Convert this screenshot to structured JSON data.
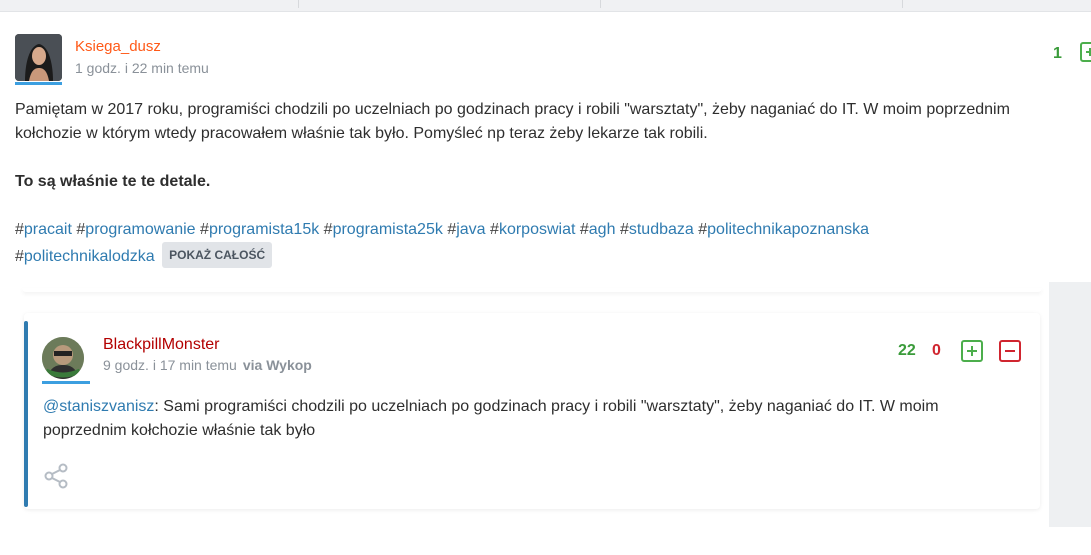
{
  "post": {
    "author": "Ksiega_dusz",
    "time": "1 godz. i 22 min temu",
    "votes": "1",
    "paragraph1": "Pamiętam w 2017 roku, programiści chodzili po uczelniach po godzinach pracy i robili \"warsztaty\", żeby naganiać do IT. W moim poprzednim kołchozie w którym wtedy pracowałem właśnie tak było. Pomyśleć np teraz żeby lekarze tak robili.",
    "paragraph2": "To są właśnie te te detale.",
    "tags": [
      "pracait",
      "programowanie",
      "programista15k",
      "programista25k",
      "java",
      "korposwiat",
      "agh",
      "studbaza",
      "politechnikapoznanska",
      "politechnikalodzka"
    ],
    "show_all": "POKAŻ CAŁOŚĆ"
  },
  "reply": {
    "author": "BlackpillMonster",
    "time": "9 godz. i 17 min temu",
    "via": "via Wykop",
    "plus_count": "22",
    "minus_count": "0",
    "mention": "@staniszvanisz",
    "text": ": Sami programiści chodzili po uczelniach po godzinach pracy i robili \"warsztaty\", żeby naganiać do IT. W moim poprzednim kołchozie właśnie tak było"
  },
  "colors": {
    "author": "#ff5917",
    "reply_author": "#b30000",
    "tag": "#2f7bb0",
    "plus": "#4cae4c",
    "minus": "#d0252f"
  },
  "icons": [
    "plus-icon",
    "minus-icon",
    "share-icon"
  ]
}
